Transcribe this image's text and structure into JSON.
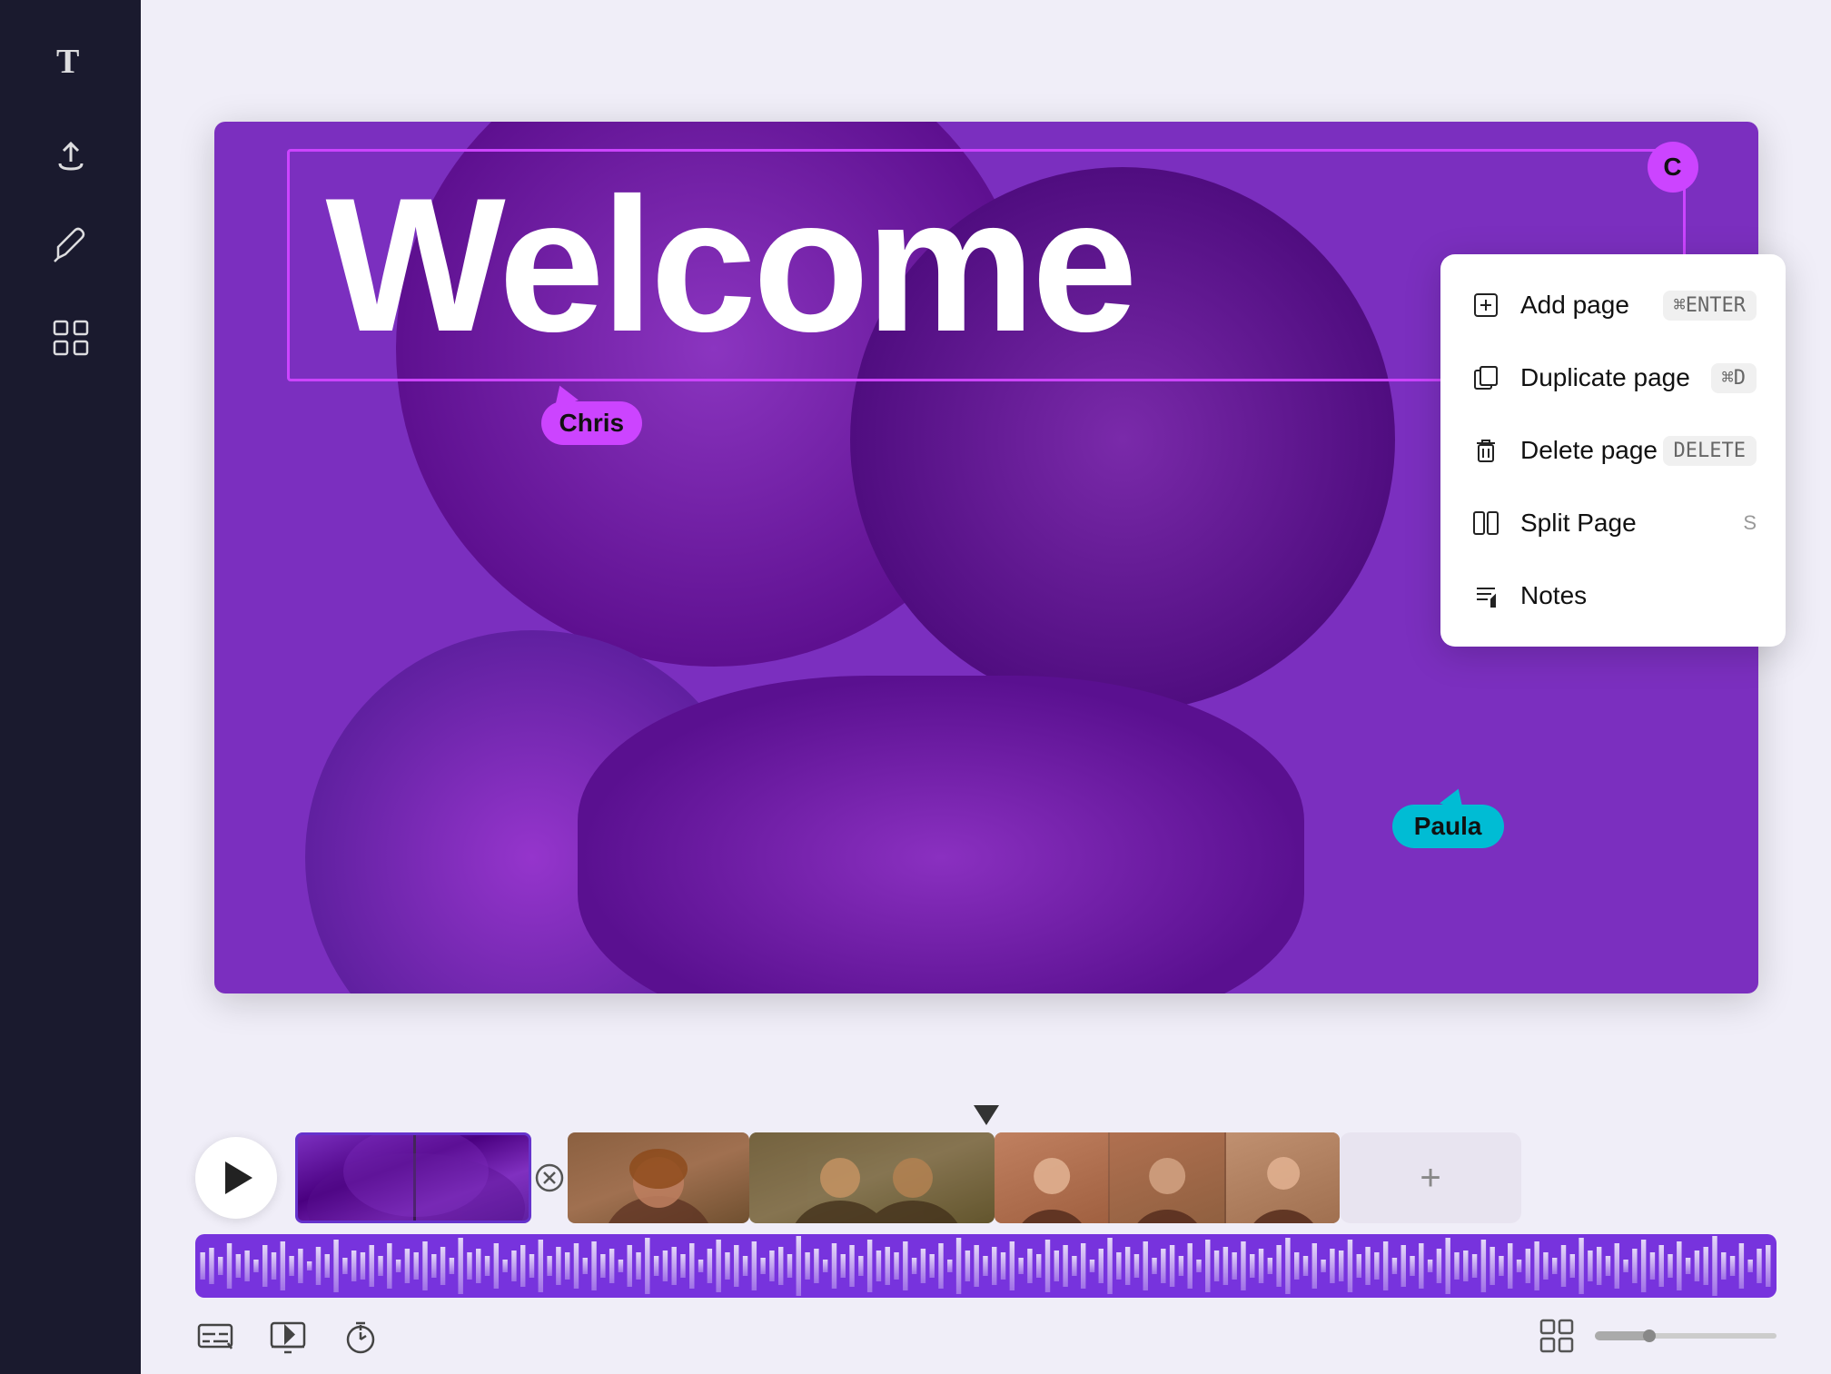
{
  "sidebar": {
    "icons": [
      {
        "name": "text-icon",
        "label": "T"
      },
      {
        "name": "upload-icon",
        "label": "↑"
      },
      {
        "name": "draw-icon",
        "label": "✏"
      },
      {
        "name": "grid-icon",
        "label": "⊞"
      }
    ]
  },
  "canvas": {
    "welcome_text": "Welcome",
    "user_badge": "C",
    "collaborators": [
      {
        "name": "Chris",
        "color": "#cc44ff"
      },
      {
        "name": "Paula",
        "color": "#00bcd4"
      }
    ]
  },
  "context_menu": {
    "items": [
      {
        "id": "add-page",
        "label": "Add page",
        "shortcut": "⌘ENTER",
        "shortcut_type": "badge"
      },
      {
        "id": "duplicate-page",
        "label": "Duplicate page",
        "shortcut": "⌘D",
        "shortcut_type": "badge"
      },
      {
        "id": "delete-page",
        "label": "Delete page",
        "shortcut": "DELETE",
        "shortcut_type": "badge"
      },
      {
        "id": "split-page",
        "label": "Split Page",
        "shortcut": "S",
        "shortcut_type": "plain"
      },
      {
        "id": "notes",
        "label": "Notes",
        "shortcut": "",
        "shortcut_type": "none"
      }
    ]
  },
  "timeline": {
    "play_button_label": "Play",
    "add_clip_label": "+"
  },
  "bottom_toolbar": {
    "icons": [
      {
        "name": "subtitles-icon"
      },
      {
        "name": "preview-icon"
      },
      {
        "name": "timer-icon"
      }
    ],
    "grid_view_label": "Grid view"
  }
}
